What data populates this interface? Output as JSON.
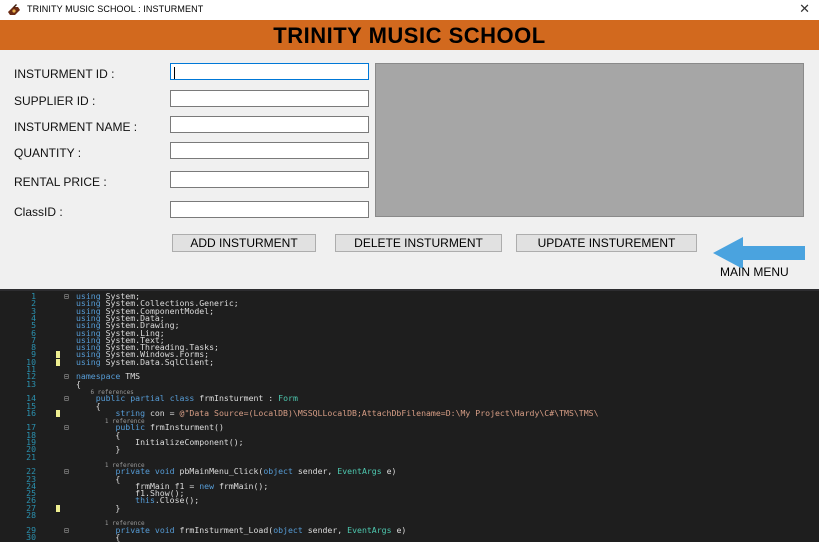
{
  "window": {
    "title": "TRINITY MUSIC SCHOOL : INSTURMENT",
    "close_glyph": "✕"
  },
  "header": {
    "title": "TRINITY MUSIC SCHOOL"
  },
  "form": {
    "fields": [
      {
        "label": "INSTURMENT ID :",
        "value": ""
      },
      {
        "label": "SUPPLIER ID :",
        "value": ""
      },
      {
        "label": "INSTURMENT NAME :",
        "value": ""
      },
      {
        "label": "QUANTITY :",
        "value": ""
      },
      {
        "label": "RENTAL PRICE :",
        "value": ""
      },
      {
        "label": "ClassID :",
        "value": ""
      }
    ],
    "buttons": {
      "add": "ADD INSTURMENT",
      "delete": "DELETE INSTURMENT",
      "update": "UPDATE INSTUREMENT"
    },
    "main_menu_label": "MAIN MENU"
  },
  "colors": {
    "banner": "#d2691e",
    "picture_box": "#a6a6a6",
    "arrow": "#4aa3df",
    "editor_bg": "#1e1e1e"
  },
  "icons": {
    "app": "app-icon",
    "arrow": "back-arrow-icon"
  },
  "editor": {
    "lines": [
      {
        "n": "1",
        "fold": "⊟",
        "code": "using System;"
      },
      {
        "n": "2",
        "code": "using System.Collections.Generic;"
      },
      {
        "n": "3",
        "code": "using System.ComponentModel;"
      },
      {
        "n": "4",
        "code": "using System.Data;"
      },
      {
        "n": "5",
        "code": "using System.Drawing;"
      },
      {
        "n": "6",
        "code": "using System.Linq;"
      },
      {
        "n": "7",
        "code": "using System.Text;"
      },
      {
        "n": "8",
        "code": "using System.Threading.Tasks;"
      },
      {
        "n": "9",
        "code": "using System.Windows.Forms;"
      },
      {
        "n": "10",
        "code": "using System.Data.SqlClient;"
      },
      {
        "n": "11",
        "code": ""
      },
      {
        "n": "12",
        "fold": "⊟",
        "code": "namespace TMS"
      },
      {
        "n": "13",
        "code": "{"
      },
      {
        "n": "",
        "code": "    6 references"
      },
      {
        "n": "14",
        "fold": "⊟",
        "code": "    public partial class frmInsturment : Form"
      },
      {
        "n": "15",
        "code": "    {"
      },
      {
        "n": "16",
        "code": "        string con = @\"Data Source=(LocalDB)\\MSSQLLocalDB;AttachDbFilename=D:\\My Project\\Hardy\\C#\\TMS\\TMS\\"
      },
      {
        "n": "",
        "code": "        1 reference"
      },
      {
        "n": "17",
        "fold": "⊟",
        "code": "        public frmInsturment()"
      },
      {
        "n": "18",
        "code": "        {"
      },
      {
        "n": "19",
        "code": "            InitializeComponent();"
      },
      {
        "n": "20",
        "code": "        }"
      },
      {
        "n": "21",
        "code": ""
      },
      {
        "n": "",
        "code": "        1 reference"
      },
      {
        "n": "22",
        "fold": "⊟",
        "code": "        private void pbMainMenu_Click(object sender, EventArgs e)"
      },
      {
        "n": "23",
        "code": "        {"
      },
      {
        "n": "24",
        "code": "            frmMain f1 = new frmMain();"
      },
      {
        "n": "25",
        "code": "            f1.Show();"
      },
      {
        "n": "26",
        "code": "            this.Close();"
      },
      {
        "n": "27",
        "code": "        }"
      },
      {
        "n": "28",
        "code": ""
      },
      {
        "n": "",
        "code": "        1 reference"
      },
      {
        "n": "29",
        "fold": "⊟",
        "code": "        private void frmInsturment_Load(object sender, EventArgs e)"
      },
      {
        "n": "30",
        "code": "        {"
      }
    ]
  }
}
